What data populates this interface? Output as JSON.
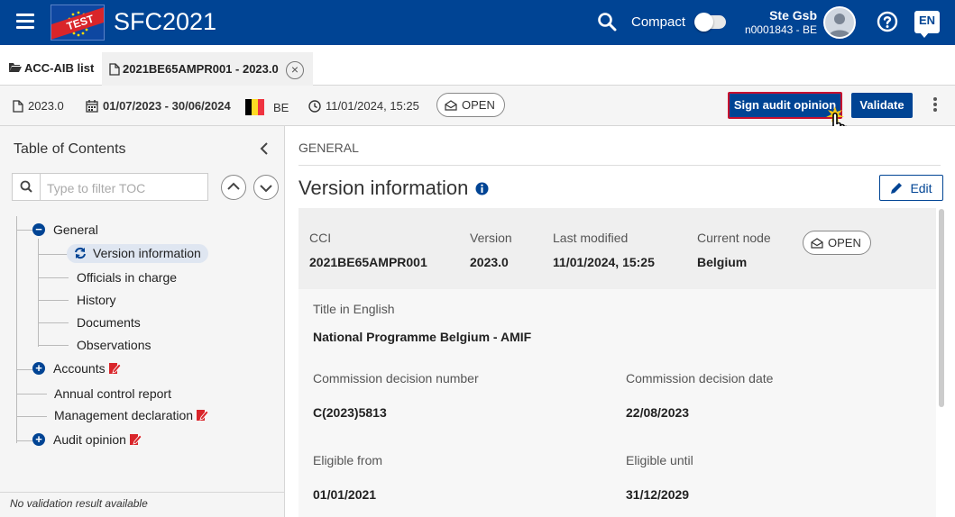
{
  "header": {
    "test_badge": "TEST",
    "app_title": "SFC2021",
    "compact_label": "Compact",
    "user_name": "Ste Gsb",
    "user_id": "n0001843 - BE",
    "language": "EN"
  },
  "tabs": [
    {
      "label": "ACC-AIB list"
    },
    {
      "label": "2021BE65AMPR001 - 2023.0"
    }
  ],
  "infobar": {
    "version": "2023.0",
    "period": "01/07/2023 - 30/06/2024",
    "country": "BE",
    "timestamp": "11/01/2024, 15:25",
    "status": "OPEN",
    "sign_button": "Sign audit opinion",
    "validate_button": "Validate"
  },
  "sidebar": {
    "title": "Table of Contents",
    "filter_placeholder": "Type to filter TOC",
    "items": [
      {
        "label": "General"
      },
      {
        "label": "Version information"
      },
      {
        "label": "Officials in charge"
      },
      {
        "label": "History"
      },
      {
        "label": "Documents"
      },
      {
        "label": "Observations"
      },
      {
        "label": "Accounts"
      },
      {
        "label": "Annual control report"
      },
      {
        "label": "Management declaration"
      },
      {
        "label": "Audit opinion"
      }
    ],
    "footer": "No validation result available"
  },
  "main": {
    "section": "GENERAL",
    "title": "Version information",
    "edit_button": "Edit",
    "fields": {
      "cci_label": "CCI",
      "cci_value": "2021BE65AMPR001",
      "version_label": "Version",
      "version_value": "2023.0",
      "last_modified_label": "Last modified",
      "last_modified_value": "11/01/2024, 15:25",
      "current_node_label": "Current node",
      "current_node_value": "Belgium",
      "status": "OPEN",
      "title_en_label": "Title in English",
      "title_en_value": "National Programme Belgium - AMIF",
      "decision_number_label": "Commission decision number",
      "decision_number_value": "C(2023)5813",
      "decision_date_label": "Commission decision date",
      "decision_date_value": "22/08/2023",
      "eligible_from_label": "Eligible from",
      "eligible_from_value": "01/01/2021",
      "eligible_until_label": "Eligible until",
      "eligible_until_value": "31/12/2029"
    }
  },
  "colors": {
    "primary": "#004494",
    "accent_red": "#c8102e",
    "flag": [
      "#000000",
      "#fdda24",
      "#ef3340"
    ]
  },
  "icons": [
    "hamburger-icon",
    "search-icon",
    "help-icon",
    "folder-icon",
    "document-icon",
    "calendar-icon",
    "clock-icon",
    "envelope-open-icon",
    "kebab-icon",
    "chevron-left-icon",
    "chevron-up-icon",
    "chevron-down-icon",
    "minus-circle-icon",
    "plus-circle-icon",
    "sync-icon",
    "edit-red-icon",
    "info-icon",
    "pencil-icon",
    "hand-cursor-icon"
  ]
}
